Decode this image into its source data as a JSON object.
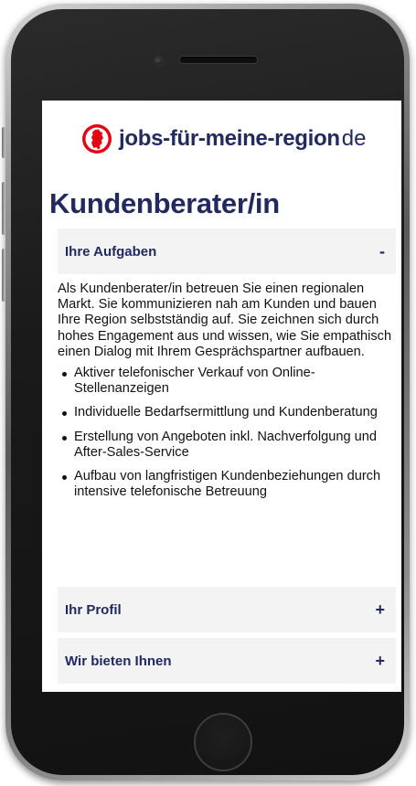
{
  "brand": {
    "logo_text": "jobs-für-meine-region",
    "logo_tld": "de",
    "accent_color": "#e30613",
    "text_color": "#22295f"
  },
  "job": {
    "title": "Kundenberater/in"
  },
  "sections": [
    {
      "label": "Ihre Aufgaben",
      "toggle": "-",
      "expanded": true,
      "intro": "Als Kundenberater/in betreuen Sie einen regionalen Markt. Sie kommunizieren nah am Kunden und bauen Ihre Region selbstständig auf. Sie zeichnen sich durch hohes Engagement aus und wissen, wie Sie empathisch einen Dialog mit Ihrem Gesprächspartner aufbauen.",
      "bullets": [
        "Aktiver telefonischer Verkauf von Online-Stellenanzeigen",
        "Individuelle Bedarfsermittlung und Kundenberatung",
        "Erstellung von Angeboten inkl. Nachverfolgung und After-Sales-Service",
        "Aufbau von langfristigen Kundenbeziehungen durch intensive telefonische Betreuung"
      ]
    },
    {
      "label": "Ihr Profil",
      "toggle": "+",
      "expanded": false
    },
    {
      "label": "Wir bieten Ihnen",
      "toggle": "+",
      "expanded": false
    }
  ]
}
